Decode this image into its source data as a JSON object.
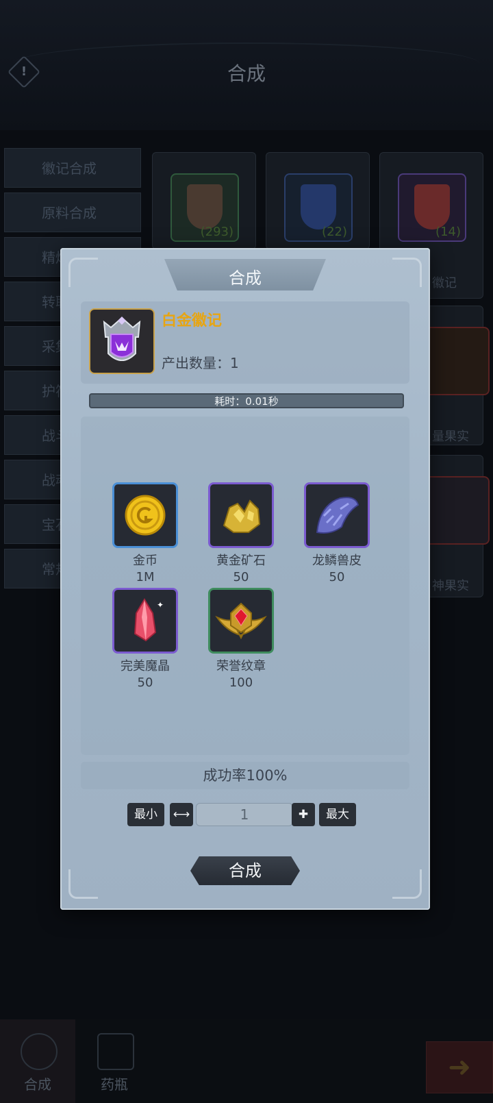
{
  "page": {
    "title": "合成"
  },
  "sidebar": {
    "items": [
      {
        "label": "徽记合成"
      },
      {
        "label": "原料合成"
      },
      {
        "label": "精炼"
      },
      {
        "label": "转职"
      },
      {
        "label": "采集"
      },
      {
        "label": "护符"
      },
      {
        "label": "战斗"
      },
      {
        "label": "战魂"
      },
      {
        "label": "宝石"
      },
      {
        "label": "常规"
      }
    ]
  },
  "grid": {
    "cards": [
      {
        "count": "(293)"
      },
      {
        "count": "(22)"
      },
      {
        "count": "(14)"
      }
    ],
    "labels": [
      "徽记",
      "量果实",
      "神果实"
    ]
  },
  "modal": {
    "title": "合成",
    "product": {
      "name": "白金徽记",
      "quantity": "产出数量：1"
    },
    "time": "耗时：0.01秒",
    "materials": [
      {
        "name": "金币",
        "qty": "1M"
      },
      {
        "name": "黄金矿石",
        "qty": "50"
      },
      {
        "name": "龙鳞兽皮",
        "qty": "50"
      },
      {
        "name": "完美魔晶",
        "qty": "50"
      },
      {
        "name": "荣誉纹章",
        "qty": "100"
      }
    ],
    "success_rate": "成功率100%",
    "min_label": "最小",
    "max_label": "最大",
    "quantity_value": "1",
    "craft_label": "合成"
  },
  "bottom_tabs": [
    {
      "label": "合成"
    },
    {
      "label": "药瓶"
    }
  ],
  "colors": {
    "accent_gold": "#e7a513",
    "frame_blue": "#4a8fd6",
    "frame_purple": "#7b5bd0",
    "frame_green": "#3f8c5e"
  }
}
